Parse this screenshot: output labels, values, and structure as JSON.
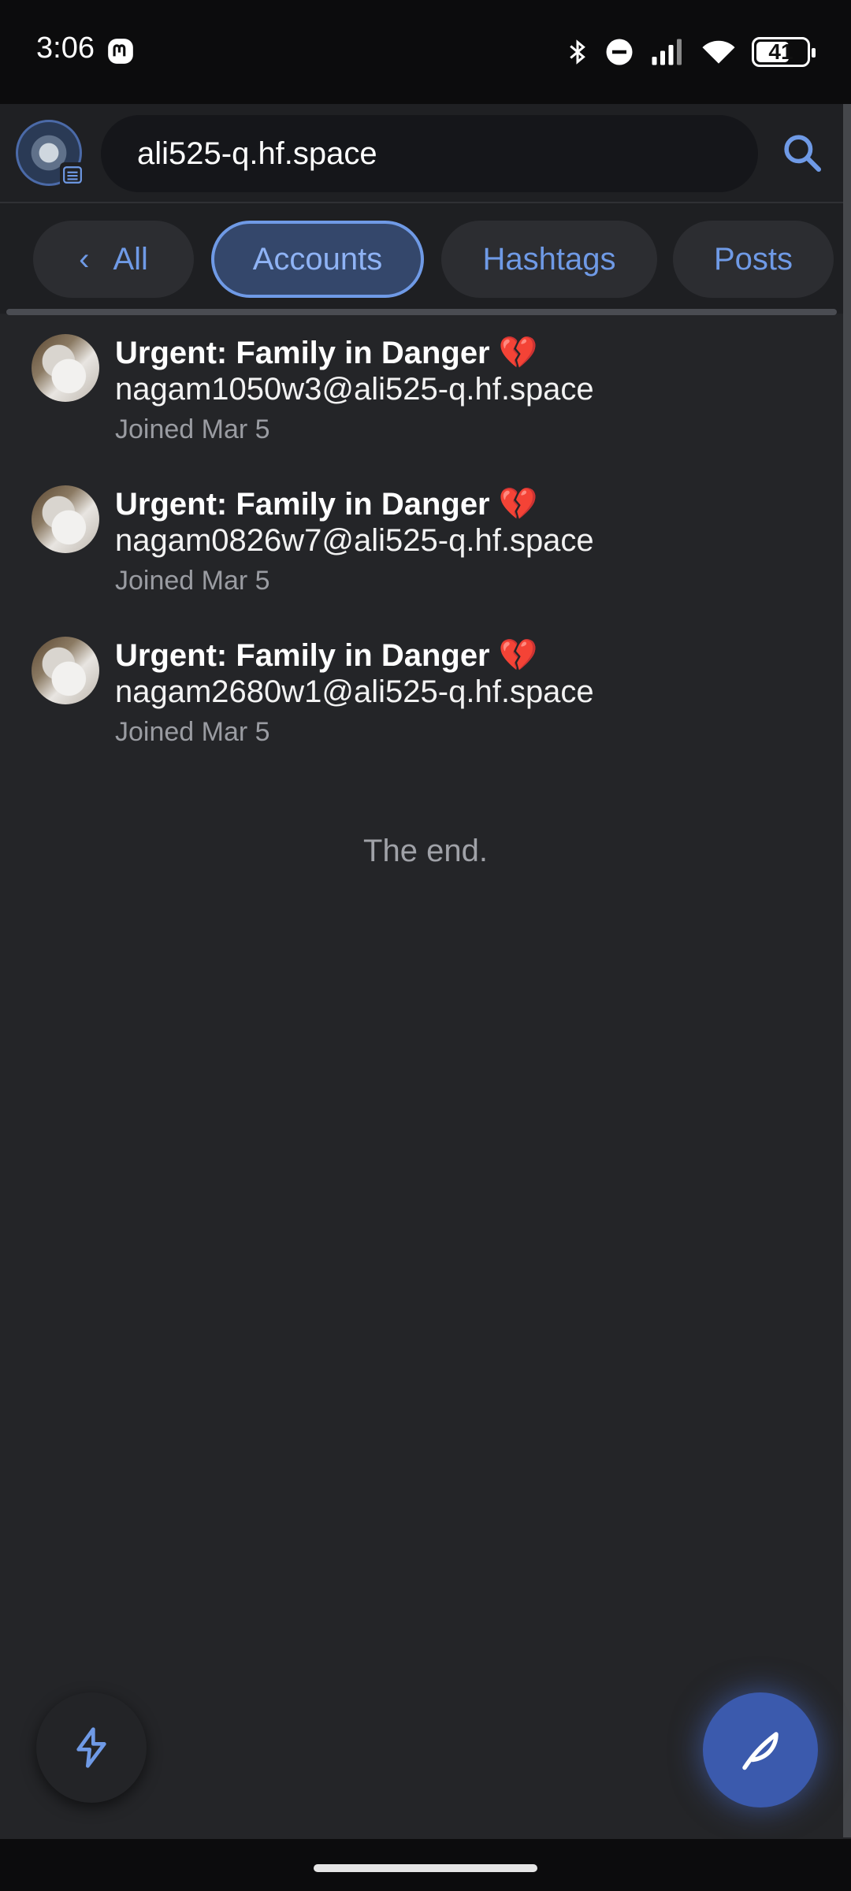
{
  "status_bar": {
    "time": "3:06",
    "battery": "41"
  },
  "header": {
    "search_value": "ali525-q.hf.space"
  },
  "filters": {
    "all": "All",
    "accounts": "Accounts",
    "hashtags": "Hashtags",
    "posts": "Posts",
    "active": "Accounts"
  },
  "results": [
    {
      "name": "Urgent: Family in Danger",
      "emoji": "💔",
      "handle": "nagam1050w3@ali525-q.hf.space",
      "joined": "Joined Mar 5"
    },
    {
      "name": "Urgent: Family in Danger",
      "emoji": "💔",
      "handle": "nagam0826w7@ali525-q.hf.space",
      "joined": "Joined Mar 5"
    },
    {
      "name": "Urgent: Family in Danger",
      "emoji": "💔",
      "handle": "nagam2680w1@ali525-q.hf.space",
      "joined": "Joined Mar 5"
    }
  ],
  "end_text": "The end.",
  "icons": {
    "status_left": "mastodon-icon",
    "status_right": [
      "bluetooth-icon",
      "do-not-disturb-icon",
      "signal-icon",
      "wifi-icon",
      "battery-icon"
    ],
    "search": "search-icon",
    "fab_left": "lightning-icon",
    "fab_right": "feather-compose-icon"
  },
  "colors": {
    "accent": "#6f9ae6",
    "fab": "#3b5aad",
    "background": "#242528"
  }
}
